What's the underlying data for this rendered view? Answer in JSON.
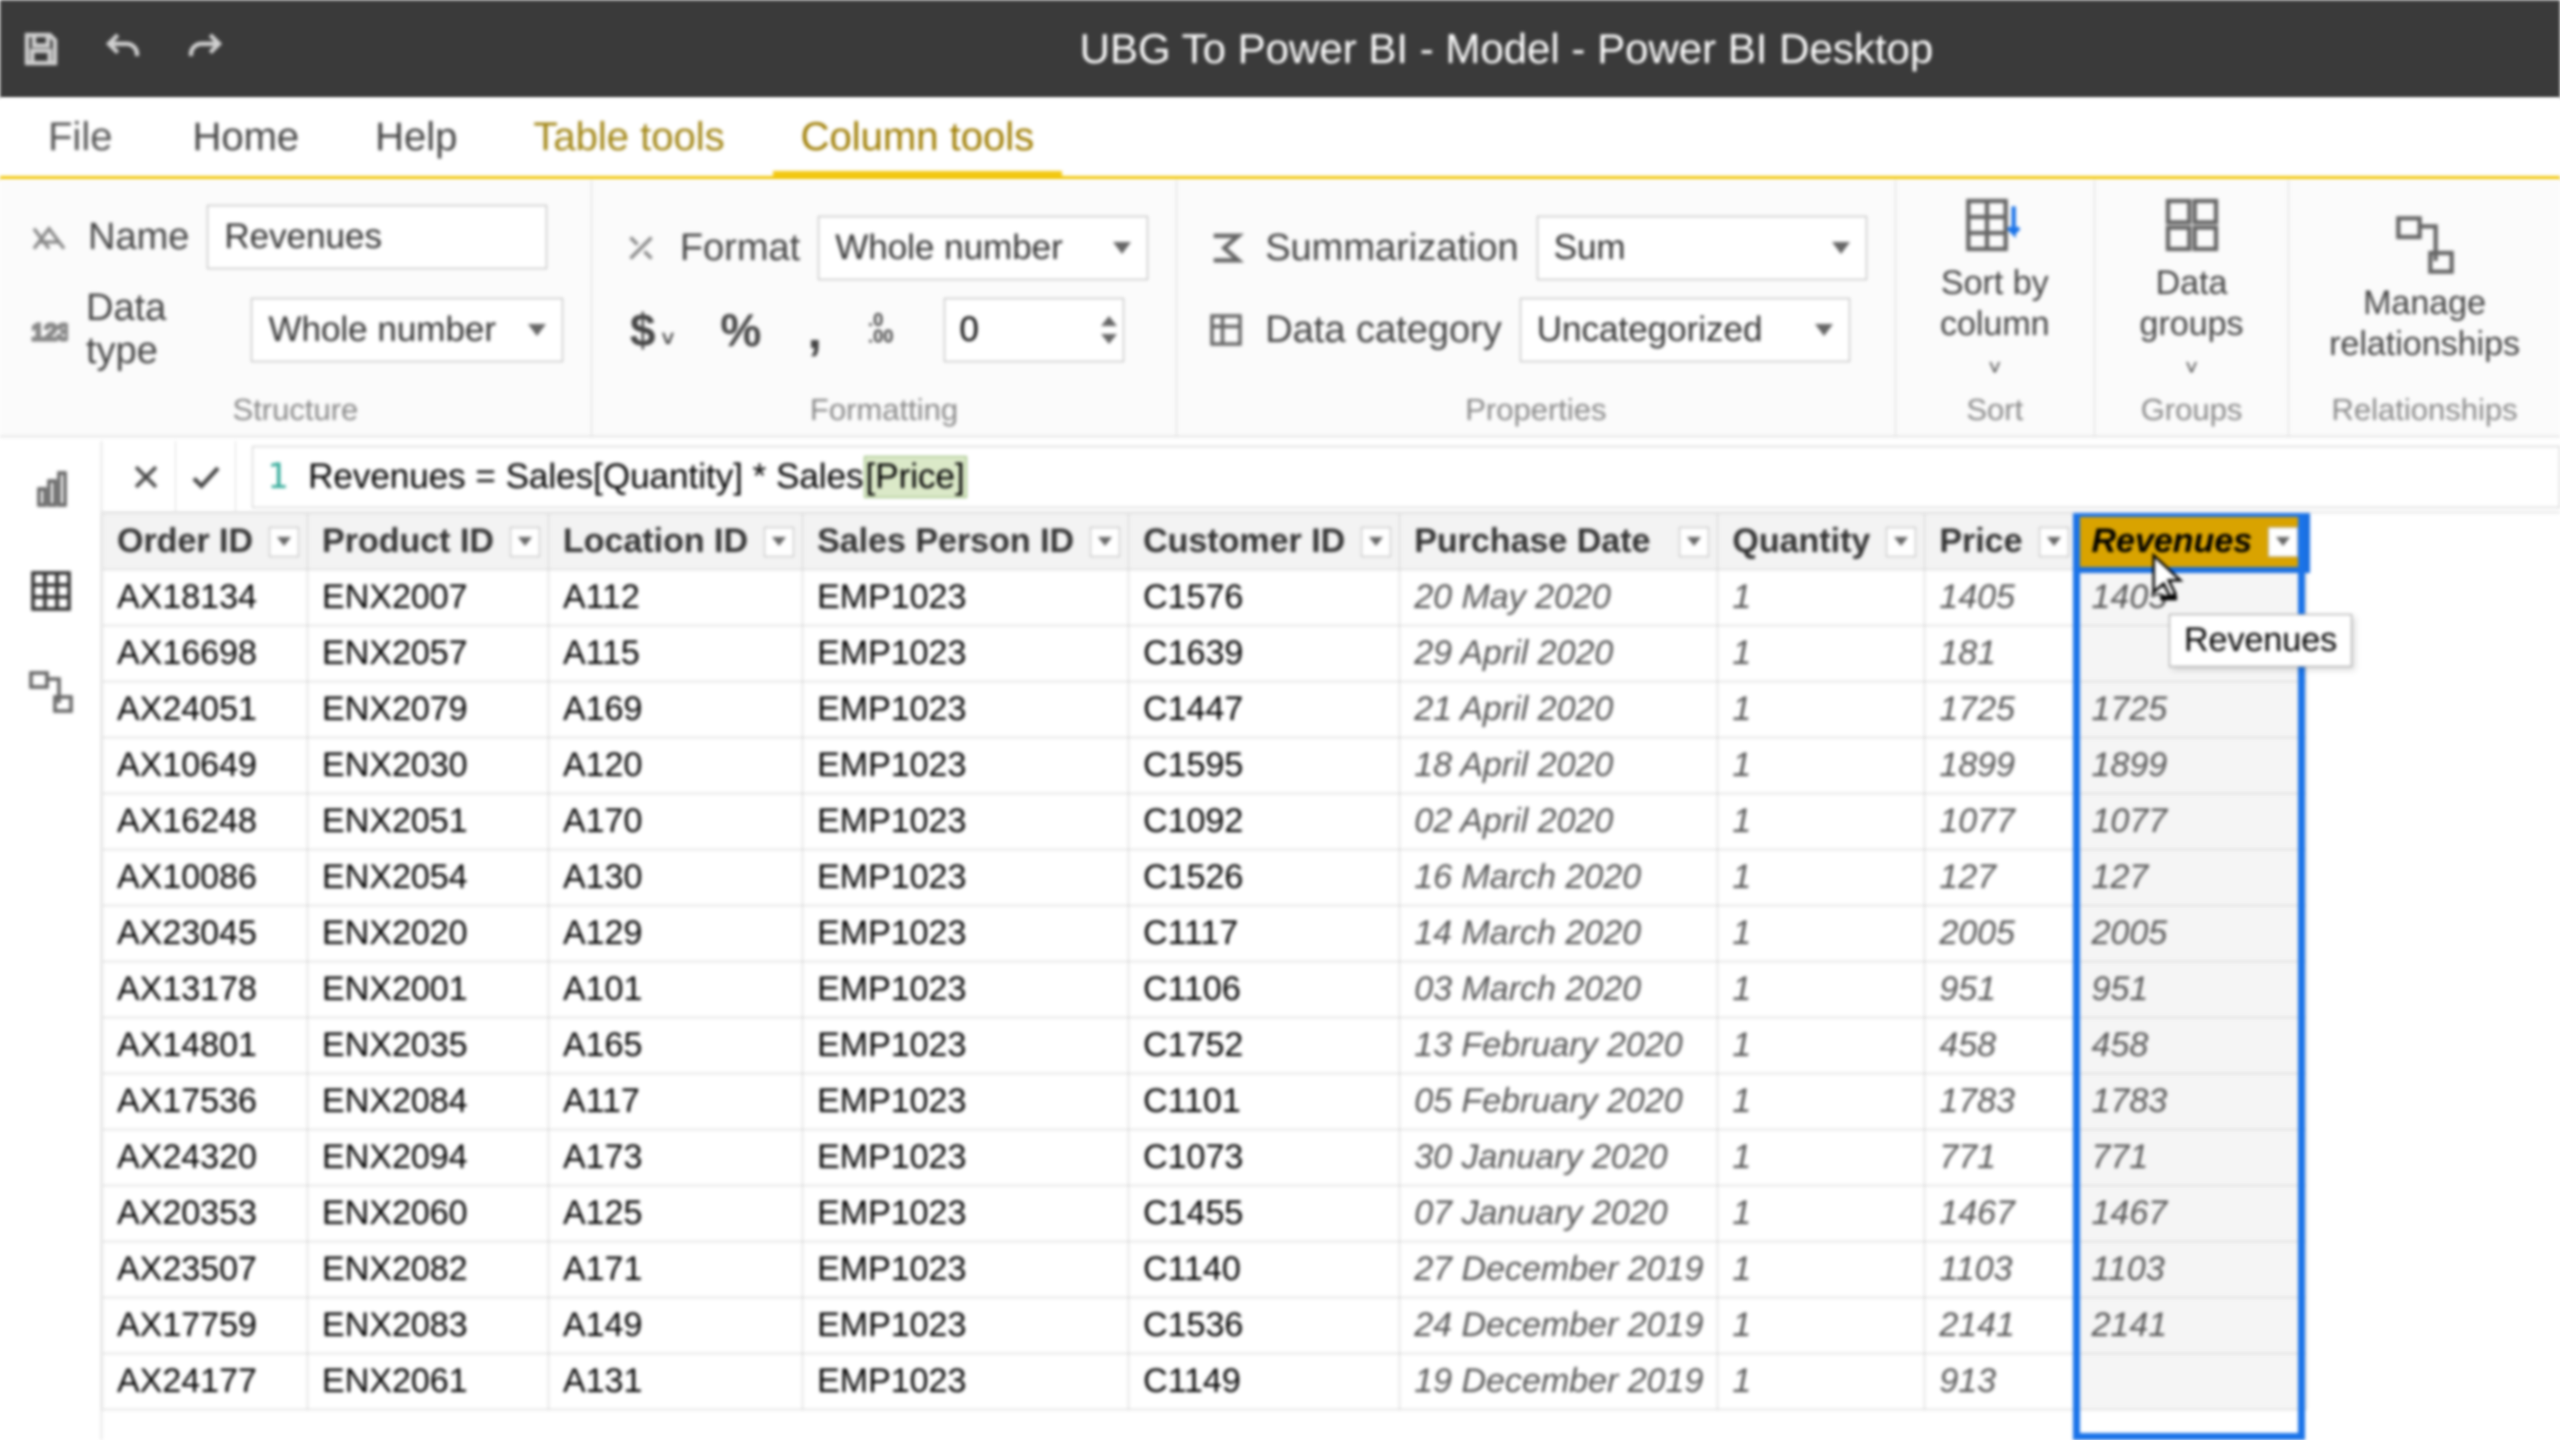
{
  "app": {
    "title": "UBG To Power BI - Model - Power BI Desktop"
  },
  "tabs": {
    "file": "File",
    "home": "Home",
    "help": "Help",
    "table_tools": "Table tools",
    "column_tools": "Column tools"
  },
  "structure": {
    "name_label": "Name",
    "name_value": "Revenues",
    "datatype_label": "Data type",
    "datatype_value": "Whole number",
    "group": "Structure"
  },
  "formatting": {
    "format_label": "Format",
    "format_value": "Whole number",
    "decimals_value": "0",
    "group": "Formatting"
  },
  "properties": {
    "summarization_label": "Summarization",
    "summarization_value": "Sum",
    "datacategory_label": "Data category",
    "datacategory_value": "Uncategorized",
    "group": "Properties"
  },
  "sort": {
    "btn": "Sort by\ncolumn",
    "group": "Sort"
  },
  "groups": {
    "btn": "Data\ngroups",
    "group": "Groups"
  },
  "relationships": {
    "btn": "Manage\nrelationships",
    "group": "Relationships"
  },
  "formula": {
    "line": "1",
    "text_pre": "Revenues = Sales[Quantity] * Sales",
    "text_hl": "[Price]"
  },
  "columns": {
    "order": "Order ID",
    "product": "Product ID",
    "location": "Location ID",
    "salesperson": "Sales Person ID",
    "customer": "Customer ID",
    "date": "Purchase Date",
    "qty": "Quantity",
    "price": "Price",
    "revenues": "Revenues"
  },
  "tooltip": "Revenues",
  "rows": [
    {
      "order": "AX18134",
      "product": "ENX2007",
      "loc": "A112",
      "sp": "EMP1023",
      "cust": "C1576",
      "date": "20 May 2020",
      "qty": "1",
      "price": "1405",
      "rev": "1405"
    },
    {
      "order": "AX16698",
      "product": "ENX2057",
      "loc": "A115",
      "sp": "EMP1023",
      "cust": "C1639",
      "date": "29 April 2020",
      "qty": "1",
      "price": "181",
      "rev": ""
    },
    {
      "order": "AX24051",
      "product": "ENX2079",
      "loc": "A169",
      "sp": "EMP1023",
      "cust": "C1447",
      "date": "21 April 2020",
      "qty": "1",
      "price": "1725",
      "rev": "1725"
    },
    {
      "order": "AX10649",
      "product": "ENX2030",
      "loc": "A120",
      "sp": "EMP1023",
      "cust": "C1595",
      "date": "18 April 2020",
      "qty": "1",
      "price": "1899",
      "rev": "1899"
    },
    {
      "order": "AX16248",
      "product": "ENX2051",
      "loc": "A170",
      "sp": "EMP1023",
      "cust": "C1092",
      "date": "02 April 2020",
      "qty": "1",
      "price": "1077",
      "rev": "1077"
    },
    {
      "order": "AX10086",
      "product": "ENX2054",
      "loc": "A130",
      "sp": "EMP1023",
      "cust": "C1526",
      "date": "16 March 2020",
      "qty": "1",
      "price": "127",
      "rev": "127"
    },
    {
      "order": "AX23045",
      "product": "ENX2020",
      "loc": "A129",
      "sp": "EMP1023",
      "cust": "C1117",
      "date": "14 March 2020",
      "qty": "1",
      "price": "2005",
      "rev": "2005"
    },
    {
      "order": "AX13178",
      "product": "ENX2001",
      "loc": "A101",
      "sp": "EMP1023",
      "cust": "C1106",
      "date": "03 March 2020",
      "qty": "1",
      "price": "951",
      "rev": "951"
    },
    {
      "order": "AX14801",
      "product": "ENX2035",
      "loc": "A165",
      "sp": "EMP1023",
      "cust": "C1752",
      "date": "13 February 2020",
      "qty": "1",
      "price": "458",
      "rev": "458"
    },
    {
      "order": "AX17536",
      "product": "ENX2084",
      "loc": "A117",
      "sp": "EMP1023",
      "cust": "C1101",
      "date": "05 February 2020",
      "qty": "1",
      "price": "1783",
      "rev": "1783"
    },
    {
      "order": "AX24320",
      "product": "ENX2094",
      "loc": "A173",
      "sp": "EMP1023",
      "cust": "C1073",
      "date": "30 January 2020",
      "qty": "1",
      "price": "771",
      "rev": "771"
    },
    {
      "order": "AX20353",
      "product": "ENX2060",
      "loc": "A125",
      "sp": "EMP1023",
      "cust": "C1455",
      "date": "07 January 2020",
      "qty": "1",
      "price": "1467",
      "rev": "1467"
    },
    {
      "order": "AX23507",
      "product": "ENX2082",
      "loc": "A171",
      "sp": "EMP1023",
      "cust": "C1140",
      "date": "27 December 2019",
      "qty": "1",
      "price": "1103",
      "rev": "1103"
    },
    {
      "order": "AX17759",
      "product": "ENX2083",
      "loc": "A149",
      "sp": "EMP1023",
      "cust": "C1536",
      "date": "24 December 2019",
      "qty": "1",
      "price": "2141",
      "rev": "2141"
    },
    {
      "order": "AX24177",
      "product": "ENX2061",
      "loc": "A131",
      "sp": "EMP1023",
      "cust": "C1149",
      "date": "19 December 2019",
      "qty": "1",
      "price": "913",
      "rev": ""
    }
  ]
}
